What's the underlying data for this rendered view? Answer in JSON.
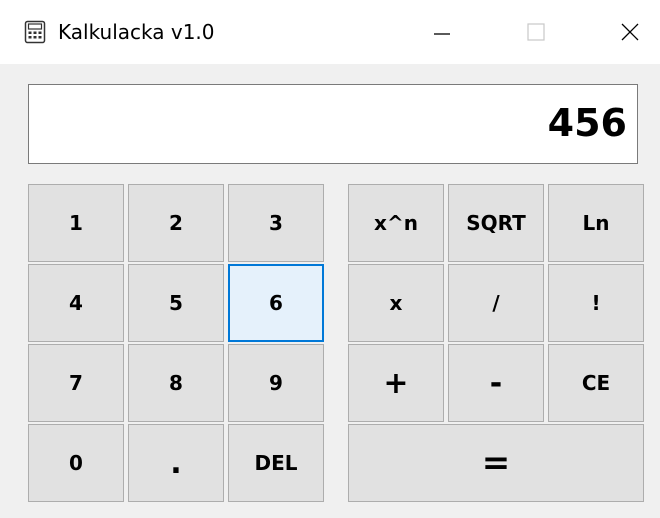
{
  "window": {
    "title": "Kalkulacka v1.0",
    "icon": "calculator-icon",
    "controls": {
      "minimize": "minimize-icon",
      "maximize": "maximize-icon",
      "close": "close-icon"
    }
  },
  "display": {
    "value": "456"
  },
  "digits": {
    "k1": "1",
    "k2": "2",
    "k3": "3",
    "k4": "4",
    "k5": "5",
    "k6": "6",
    "k7": "7",
    "k8": "8",
    "k9": "9",
    "k0": "0",
    "dot": ".",
    "del": "DEL"
  },
  "ops": {
    "pow": "x^n",
    "sqrt": "SQRT",
    "ln": "Ln",
    "mul": "x",
    "div": "/",
    "fact": "!",
    "add": "+",
    "sub": "-",
    "ce": "CE",
    "eq": "="
  },
  "colors": {
    "focus_border": "#0078d7",
    "focus_fill": "#e5f1fb",
    "key_fill": "#e1e1e1",
    "client_bg": "#f0f0f0"
  }
}
